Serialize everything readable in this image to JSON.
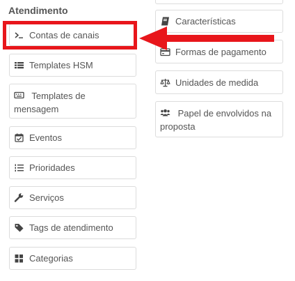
{
  "section": {
    "title": "Atendimento"
  },
  "left_items": [
    {
      "label": "Contas de canais",
      "icon": "terminal-icon"
    },
    {
      "label": "Templates HSM",
      "icon": "list-icon"
    },
    {
      "label": "Templates de mensagem",
      "icon": "keyboard-icon"
    },
    {
      "label": "Eventos",
      "icon": "calendar-check-icon"
    },
    {
      "label": "Prioridades",
      "icon": "ordered-list-icon"
    },
    {
      "label": "Serviços",
      "icon": "wrench-icon"
    },
    {
      "label": "Tags de atendimento",
      "icon": "tag-icon"
    },
    {
      "label": "Categorias",
      "icon": "grid-icon"
    }
  ],
  "right_items": [
    {
      "label": "Características",
      "icon": "book-icon"
    },
    {
      "label": "Formas de pagamento",
      "icon": "credit-card-icon"
    },
    {
      "label": "Unidades de medida",
      "icon": "balance-scale-icon"
    },
    {
      "label": "Papel de envolvidos na proposta",
      "icon": "users-icon"
    }
  ],
  "annotation": {
    "highlight_color": "#e8161b",
    "target": "Contas de canais"
  }
}
